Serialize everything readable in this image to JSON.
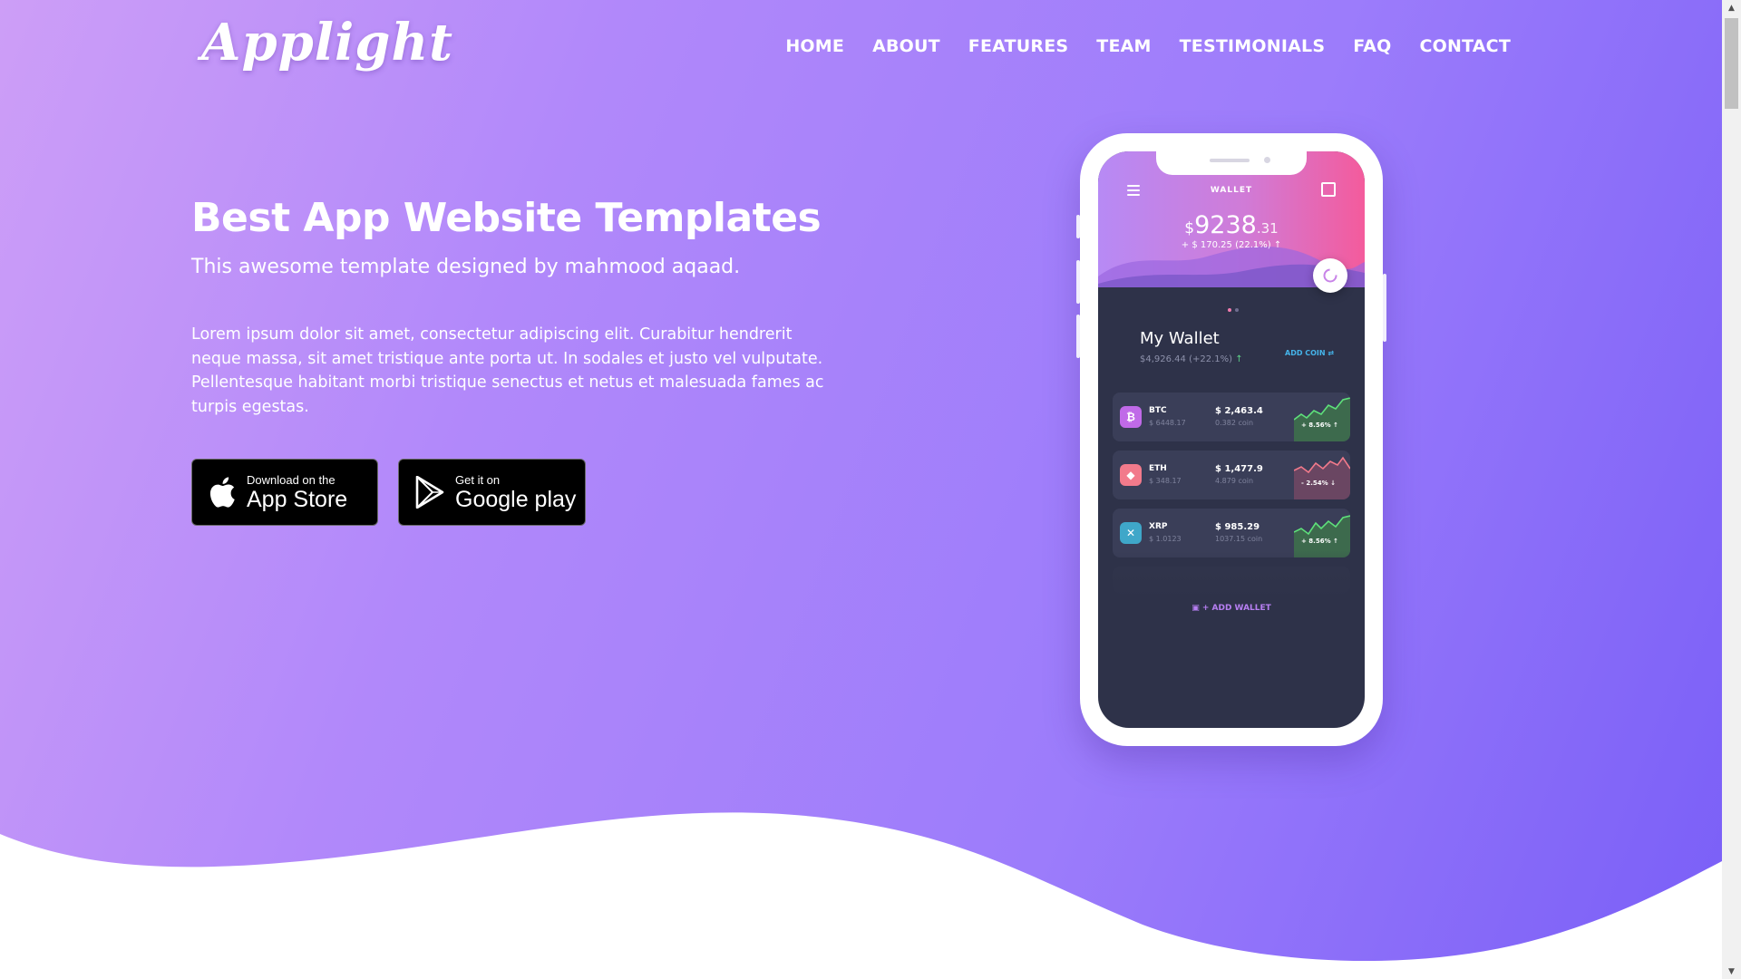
{
  "brand": {
    "logo_text": "Applight"
  },
  "nav": {
    "items": [
      {
        "label": "HOME"
      },
      {
        "label": "ABOUT"
      },
      {
        "label": "FEATURES"
      },
      {
        "label": "TEAM"
      },
      {
        "label": "TESTIMONIALS"
      },
      {
        "label": "FAQ"
      },
      {
        "label": "CONTACT"
      }
    ]
  },
  "hero": {
    "title": "Best App Website Templates",
    "subtitle": "This awesome template designed by mahmood aqaad.",
    "paragraph": "Lorem ipsum dolor sit amet, consectetur adipiscing elit. Curabitur hendrerit neque massa, sit amet tristique ante porta ut. In sodales et justo vel vulputate. Pellentesque habitant morbi tristique senectus et netus et malesuada fames ac turpis egestas."
  },
  "buttons": {
    "app_store": {
      "small": "Download on the",
      "big": "App Store"
    },
    "google_play": {
      "small": "Get it on",
      "big": "Google play"
    }
  },
  "colors": {
    "gradient_start": "#cd9ef7",
    "gradient_end": "#7a5ff7",
    "button_bg": "#000000"
  },
  "phone": {
    "header_title": "WALLET",
    "balance_currency": "$",
    "balance_main": "9238",
    "balance_cents": ".31",
    "balance_change": "+ $ 170.25 (22.1%) ↑",
    "wallet_title": "My Wallet",
    "wallet_total": "$4,926.44 (+22.1%)",
    "wallet_total_arrow": "↑",
    "add_coin_label": "ADD COIN",
    "add_wallet_label": "+ ADD WALLET",
    "coins": [
      {
        "symbol": "BTC",
        "sub": "$ 6448.17",
        "price": "$ 2,463.4",
        "qty": "0.382 coin",
        "change": "+ 8.56% ↑",
        "icon": "bitcoin-icon",
        "color": "#c06ae8"
      },
      {
        "symbol": "ETH",
        "sub": "$ 348.17",
        "price": "$ 1,477.9",
        "qty": "4.879 coin",
        "change": "- 2.54% ↓",
        "icon": "ethereum-icon",
        "color": "#f27a8b"
      },
      {
        "symbol": "XRP",
        "sub": "$ 1.0123",
        "price": "$ 985.29",
        "qty": "1037.15 coin",
        "change": "+ 8.56% ↑",
        "icon": "ripple-icon",
        "color": "#3fa7c9"
      }
    ]
  }
}
